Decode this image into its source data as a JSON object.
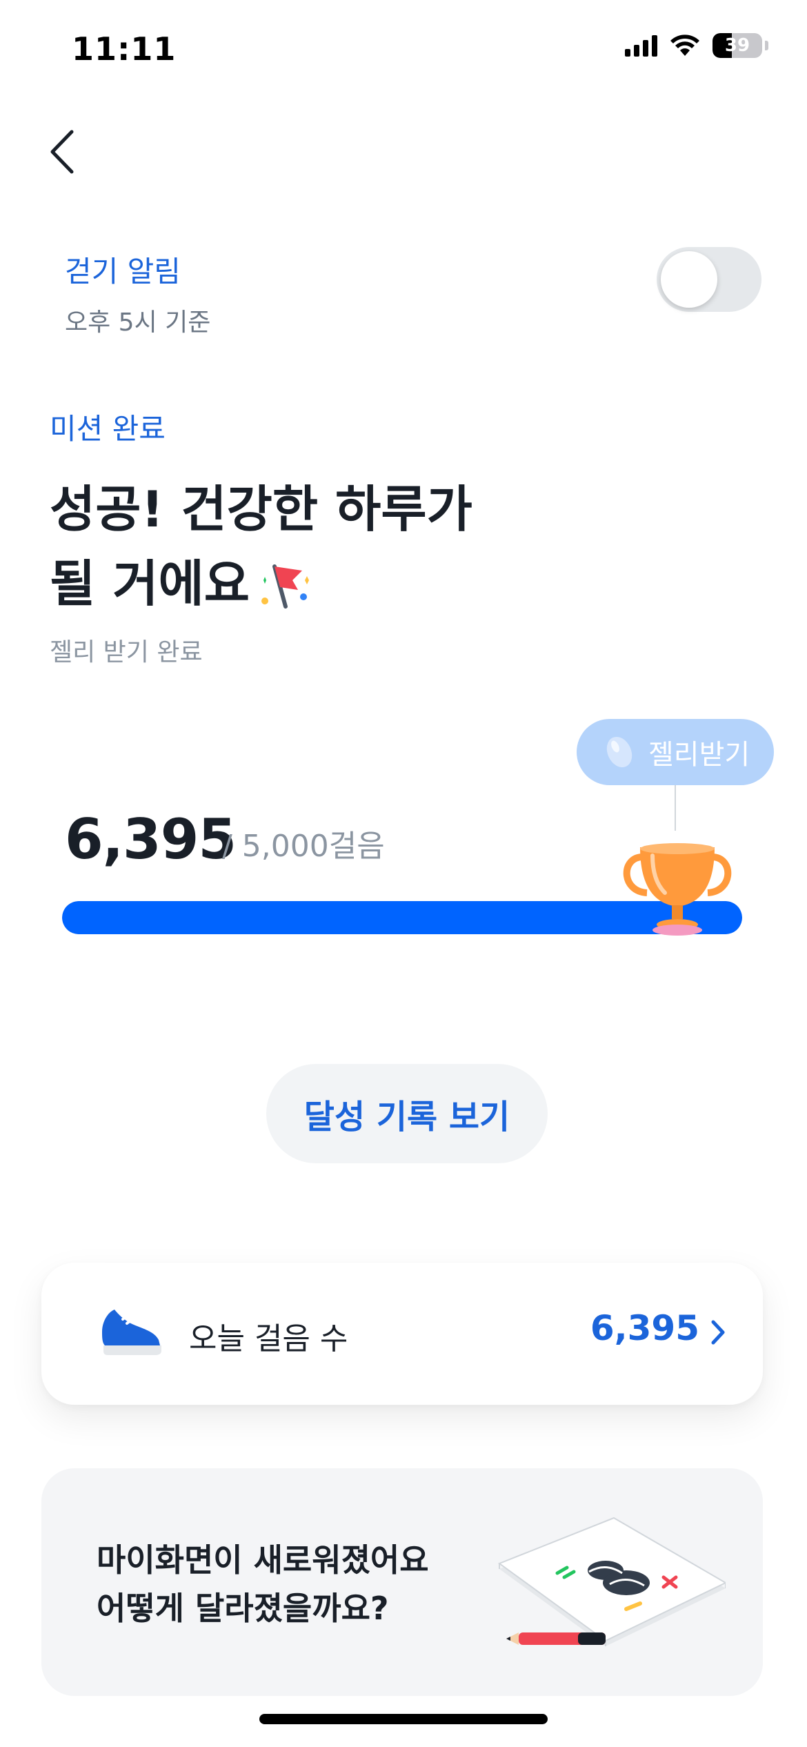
{
  "status_bar": {
    "time": "11:11",
    "battery": "39",
    "battery_level": 0.39
  },
  "walk_alert": {
    "title": "걷기 알림",
    "subtitle": "오후 5시 기준",
    "enabled": false
  },
  "mission": {
    "label": "미션 완료",
    "headline_line1": "성공! 건강한 하루가",
    "headline_line2": "될 거에요",
    "status": "젤리 받기 완료"
  },
  "steps": {
    "jelly_button": "젤리받기",
    "count": "6,395",
    "goal": "/ 5,000걸음",
    "progress": 1.0
  },
  "record_button": "달성 기록 보기",
  "today": {
    "label": "오늘 걸음 수",
    "value": "6,395"
  },
  "news": {
    "line1": "마이화면이 새로워졌어요",
    "line2": "어떻게 달라졌을까요?"
  },
  "colors": {
    "accent": "#1b64da",
    "progress": "#0064ff",
    "bubble": "#b4d3fb",
    "trophy": "#ff9a3c"
  }
}
